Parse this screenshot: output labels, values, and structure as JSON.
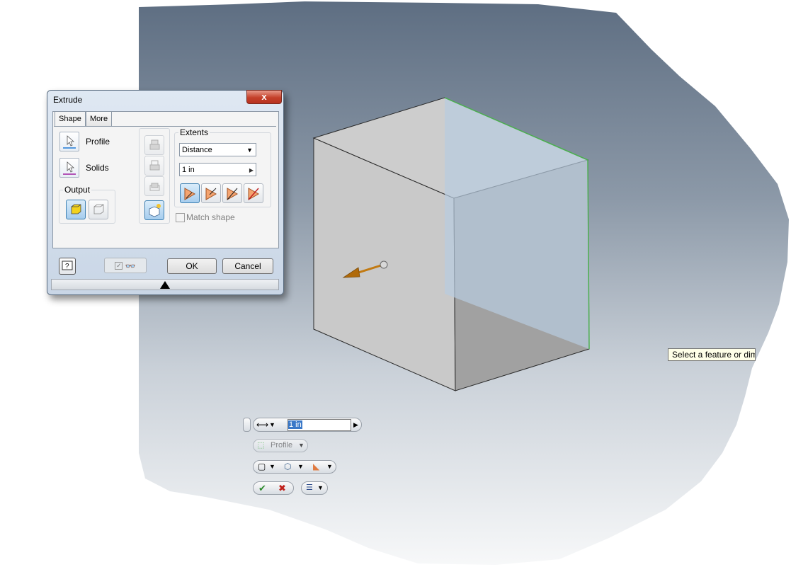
{
  "dialog": {
    "title": "Extrude",
    "close_label": "x",
    "tabs": [
      {
        "label": "Shape"
      },
      {
        "label": "More"
      }
    ],
    "profile_label": "Profile",
    "solids_label": "Solids",
    "output_label": "Output",
    "extents_label": "Extents",
    "extents_type": "Distance",
    "distance_value": "1 in",
    "match_shape_label": "Match shape",
    "ok_label": "OK",
    "cancel_label": "Cancel"
  },
  "minitoolbar": {
    "distance_value": "1 in",
    "profile_label": "Profile"
  },
  "tooltip": {
    "text": "Select a feature or dime"
  },
  "colors": {
    "viewport_top": "#5f6f83",
    "viewport_bottom": "#f2f4f6",
    "cube_edge_highlight": "#4caf50",
    "arrow": "#c27a12",
    "ok_green": "#2e8b2e",
    "cancel_red": "#c0201a"
  }
}
